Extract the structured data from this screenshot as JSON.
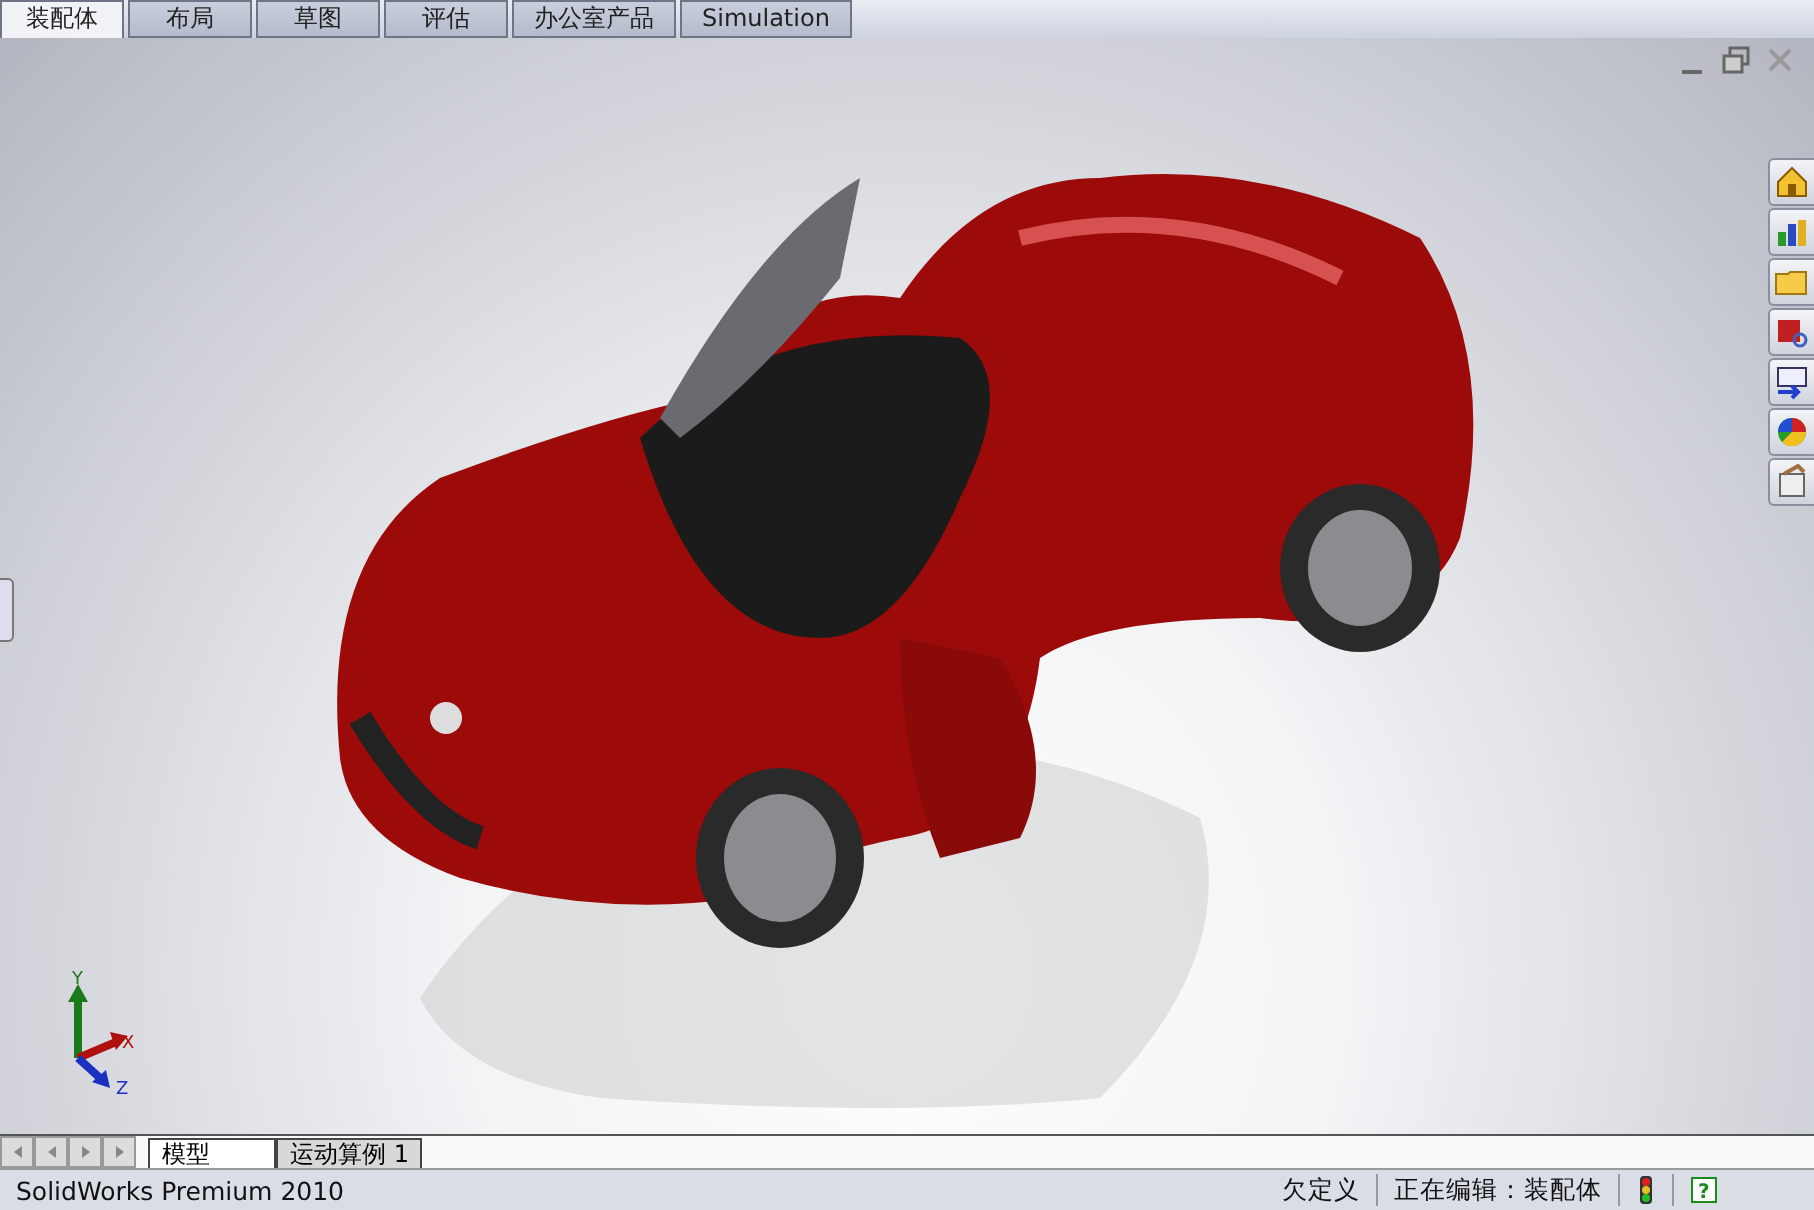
{
  "tabs": [
    {
      "label": "装配体",
      "selected": true
    },
    {
      "label": "布局",
      "selected": false
    },
    {
      "label": "草图",
      "selected": false
    },
    {
      "label": "评估",
      "selected": false
    },
    {
      "label": "办公室产品",
      "selected": false
    },
    {
      "label": "Simulation",
      "selected": false
    }
  ],
  "triad": {
    "y": "Y",
    "x": "X",
    "z": "Z"
  },
  "bottom_tabs": [
    {
      "label": "模型",
      "selected": true
    },
    {
      "label": "运动算例 1",
      "selected": false
    }
  ],
  "status_bar": {
    "product": "SolidWorks Premium 2010",
    "definition": "欠定义",
    "editing": "正在编辑：装配体",
    "help": "?"
  }
}
